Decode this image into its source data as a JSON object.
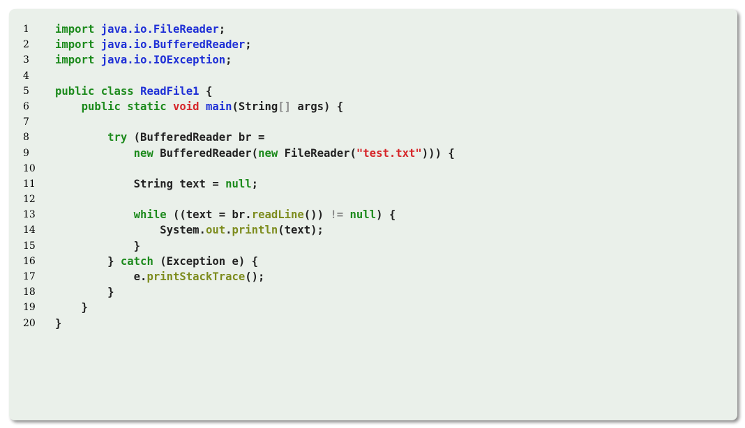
{
  "colors": {
    "background": "#eaf0ea",
    "keyword": "#1c8a1c",
    "type_name": "#1e2fd6",
    "string": "#d6262a",
    "method": "#7d8c1e",
    "plain": "#222222"
  },
  "code": {
    "language": "java",
    "lines": [
      {
        "number": "1",
        "tokens": [
          {
            "t": "kw",
            "v": "import"
          },
          {
            "t": "plain",
            "v": " "
          },
          {
            "t": "type",
            "v": "java.io.FileReader"
          },
          {
            "t": "plain",
            "v": ";"
          }
        ]
      },
      {
        "number": "2",
        "tokens": [
          {
            "t": "kw",
            "v": "import"
          },
          {
            "t": "plain",
            "v": " "
          },
          {
            "t": "type",
            "v": "java.io.BufferedReader"
          },
          {
            "t": "plain",
            "v": ";"
          }
        ]
      },
      {
        "number": "3",
        "tokens": [
          {
            "t": "kw",
            "v": "import"
          },
          {
            "t": "plain",
            "v": " "
          },
          {
            "t": "type",
            "v": "java.io.IOException"
          },
          {
            "t": "plain",
            "v": ";"
          }
        ]
      },
      {
        "number": "4",
        "tokens": []
      },
      {
        "number": "5",
        "tokens": [
          {
            "t": "kw",
            "v": "public class"
          },
          {
            "t": "plain",
            "v": " "
          },
          {
            "t": "type",
            "v": "ReadFile1"
          },
          {
            "t": "plain",
            "v": " {"
          }
        ]
      },
      {
        "number": "6",
        "tokens": [
          {
            "t": "plain",
            "v": "    "
          },
          {
            "t": "kw",
            "v": "public static"
          },
          {
            "t": "plain",
            "v": " "
          },
          {
            "t": "str",
            "v": "void"
          },
          {
            "t": "plain",
            "v": " "
          },
          {
            "t": "type",
            "v": "main"
          },
          {
            "t": "plain",
            "v": "(String"
          },
          {
            "t": "br",
            "v": "[]"
          },
          {
            "t": "plain",
            "v": " args) {"
          }
        ]
      },
      {
        "number": "7",
        "tokens": []
      },
      {
        "number": "8",
        "tokens": [
          {
            "t": "plain",
            "v": "        "
          },
          {
            "t": "kw",
            "v": "try"
          },
          {
            "t": "plain",
            "v": " (BufferedReader br ="
          }
        ]
      },
      {
        "number": "9",
        "tokens": [
          {
            "t": "plain",
            "v": "            "
          },
          {
            "t": "kw",
            "v": "new"
          },
          {
            "t": "plain",
            "v": " BufferedReader("
          },
          {
            "t": "kw",
            "v": "new"
          },
          {
            "t": "plain",
            "v": " FileReader("
          },
          {
            "t": "str",
            "v": "\"test.txt\""
          },
          {
            "t": "plain",
            "v": "))) {"
          }
        ]
      },
      {
        "number": "10",
        "tokens": []
      },
      {
        "number": "11",
        "tokens": [
          {
            "t": "plain",
            "v": "            String text = "
          },
          {
            "t": "kw",
            "v": "null"
          },
          {
            "t": "plain",
            "v": ";"
          }
        ]
      },
      {
        "number": "12",
        "tokens": []
      },
      {
        "number": "13",
        "tokens": [
          {
            "t": "plain",
            "v": "            "
          },
          {
            "t": "kw",
            "v": "while"
          },
          {
            "t": "plain",
            "v": " ((text = br."
          },
          {
            "t": "fn",
            "v": "readLine"
          },
          {
            "t": "plain",
            "v": "()) "
          },
          {
            "t": "br",
            "v": "!="
          },
          {
            "t": "plain",
            "v": " "
          },
          {
            "t": "kw",
            "v": "null"
          },
          {
            "t": "plain",
            "v": ") {"
          }
        ]
      },
      {
        "number": "14",
        "tokens": [
          {
            "t": "plain",
            "v": "                System."
          },
          {
            "t": "fn",
            "v": "out"
          },
          {
            "t": "plain",
            "v": "."
          },
          {
            "t": "fn",
            "v": "println"
          },
          {
            "t": "plain",
            "v": "(text);"
          }
        ]
      },
      {
        "number": "15",
        "tokens": [
          {
            "t": "plain",
            "v": "            }"
          }
        ]
      },
      {
        "number": "16",
        "tokens": [
          {
            "t": "plain",
            "v": "        } "
          },
          {
            "t": "kw",
            "v": "catch"
          },
          {
            "t": "plain",
            "v": " (Exception e) {"
          }
        ]
      },
      {
        "number": "17",
        "tokens": [
          {
            "t": "plain",
            "v": "            e."
          },
          {
            "t": "fn",
            "v": "printStackTrace"
          },
          {
            "t": "plain",
            "v": "();"
          }
        ]
      },
      {
        "number": "18",
        "tokens": [
          {
            "t": "plain",
            "v": "        }"
          }
        ]
      },
      {
        "number": "19",
        "tokens": [
          {
            "t": "plain",
            "v": "    }"
          }
        ]
      },
      {
        "number": "20",
        "tokens": [
          {
            "t": "plain",
            "v": "}"
          }
        ]
      }
    ]
  }
}
